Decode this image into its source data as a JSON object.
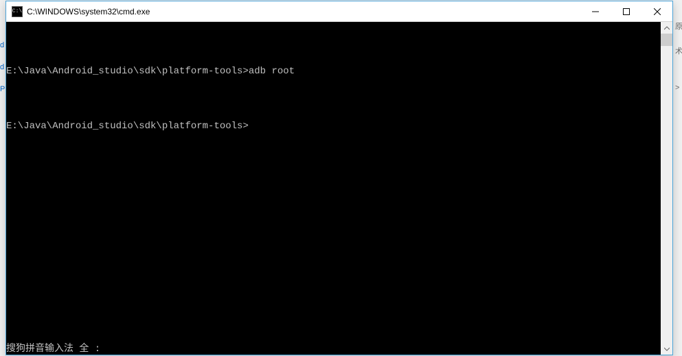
{
  "window": {
    "icon_text": "C:\\",
    "title": "C:\\WINDOWS\\system32\\cmd.exe"
  },
  "terminal": {
    "lines": [
      {
        "prompt": "E:\\Java\\Android_studio\\sdk\\platform-tools>",
        "command": "adb root"
      },
      {
        "prompt": "",
        "command": ""
      },
      {
        "prompt": "E:\\Java\\Android_studio\\sdk\\platform-tools>",
        "command": ""
      }
    ],
    "ime_status": "搜狗拼音输入法 全 :"
  },
  "bg": {
    "left_chars": [
      "d",
      "d",
      "P"
    ],
    "right_chars": [
      "原",
      "术",
      "",
      ">"
    ]
  }
}
